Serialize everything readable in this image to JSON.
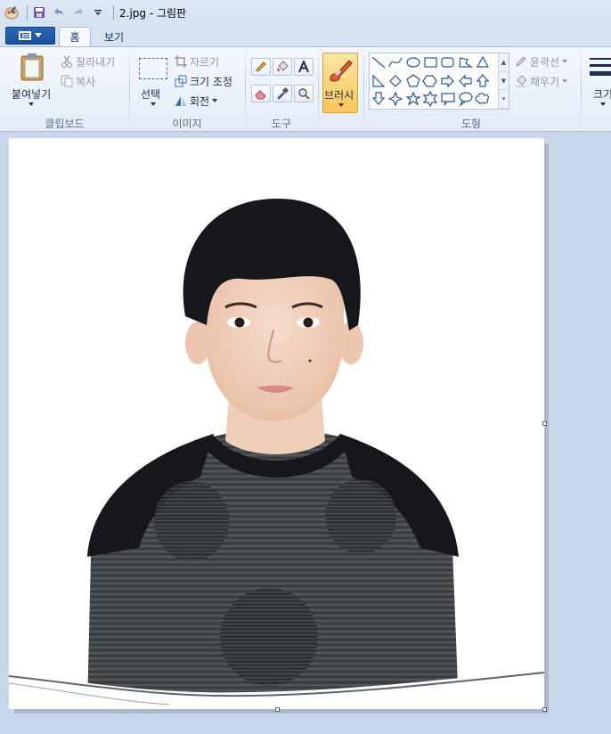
{
  "window": {
    "title": "2.jpg - 그림판"
  },
  "quick_access": {
    "icons": [
      "paint-app-icon",
      "save-icon",
      "undo-icon",
      "redo-icon",
      "customize-dropdown-icon"
    ]
  },
  "tabs": [
    {
      "label": "홈",
      "active": true
    },
    {
      "label": "보기",
      "active": false
    }
  ],
  "ribbon": {
    "clipboard": {
      "paste_label": "붙여넣기",
      "cut_label": "잘라내기",
      "copy_label": "복사",
      "group_label": "클립보드"
    },
    "image": {
      "select_label": "선택",
      "crop_label": "자르기",
      "resize_label": "크기 조정",
      "rotate_label": "회전",
      "group_label": "이미지"
    },
    "tools": {
      "group_label": "도구"
    },
    "brushes": {
      "label": "브러시"
    },
    "shapes": {
      "outline_label": "윤곽선",
      "fill_label": "채우기",
      "group_label": "도형"
    },
    "size": {
      "label": "크기"
    }
  },
  "colors": {
    "accent": "#1a4f9c",
    "brush_highlight": "#f7c65a",
    "workspace": "#c9d7ea",
    "sweater": "#3e4244",
    "hair": "#15171a"
  }
}
